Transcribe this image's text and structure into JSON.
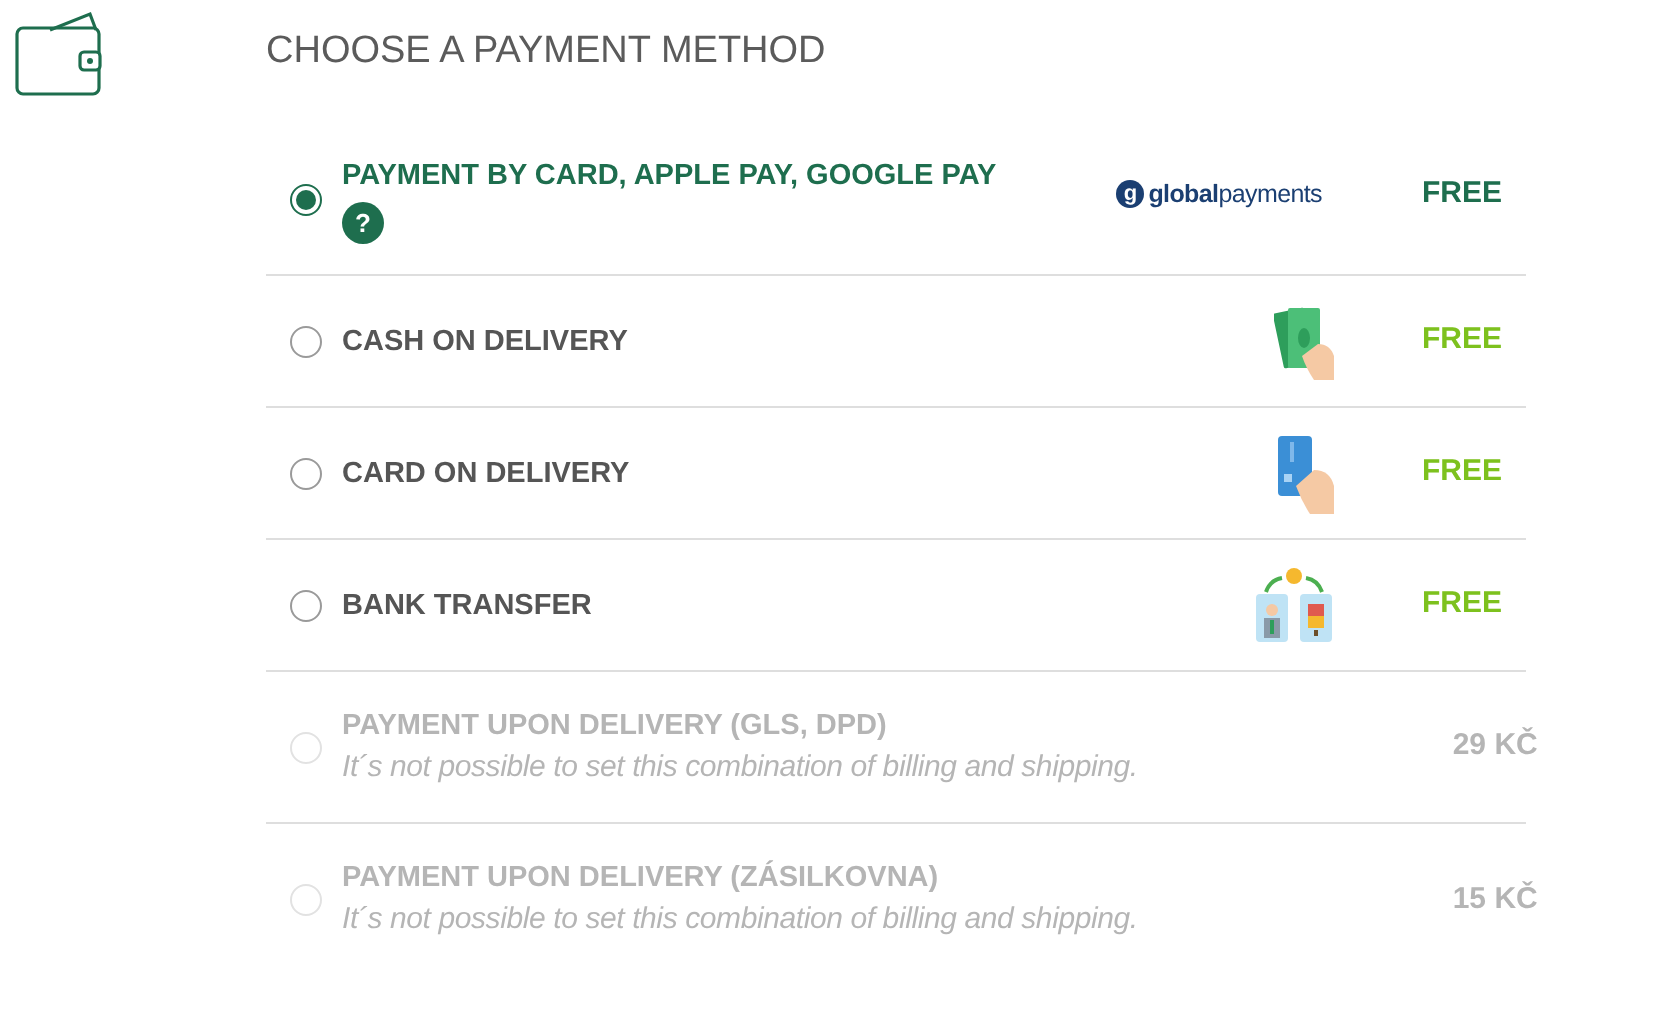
{
  "title": "CHOOSE A PAYMENT METHOD",
  "methods": [
    {
      "label": "PAYMENT BY CARD, APPLE PAY, GOOGLE PAY",
      "help": "?",
      "kind": "logo",
      "logo_mark": "g",
      "logo_text": "**global**payments",
      "price": "FREE",
      "selected": true,
      "disabled": false
    },
    {
      "label": "CASH ON DELIVERY",
      "kind": "cash",
      "price": "FREE",
      "selected": false,
      "disabled": false
    },
    {
      "label": "CARD ON DELIVERY",
      "kind": "card",
      "price": "FREE",
      "selected": false,
      "disabled": false
    },
    {
      "label": "BANK TRANSFER",
      "kind": "transfer",
      "price": "FREE",
      "selected": false,
      "disabled": false
    },
    {
      "label": "PAYMENT UPON DELIVERY (GLS, DPD)",
      "note": "It´s not possible to set this combination of billing and shipping.",
      "price": "29 KČ",
      "selected": false,
      "disabled": true
    },
    {
      "label": "PAYMENT UPON DELIVERY (ZÁSILKOVNA)",
      "note": "It´s not possible to set this combination of billing and shipping.",
      "price": "15 KČ",
      "selected": false,
      "disabled": true
    }
  ]
}
